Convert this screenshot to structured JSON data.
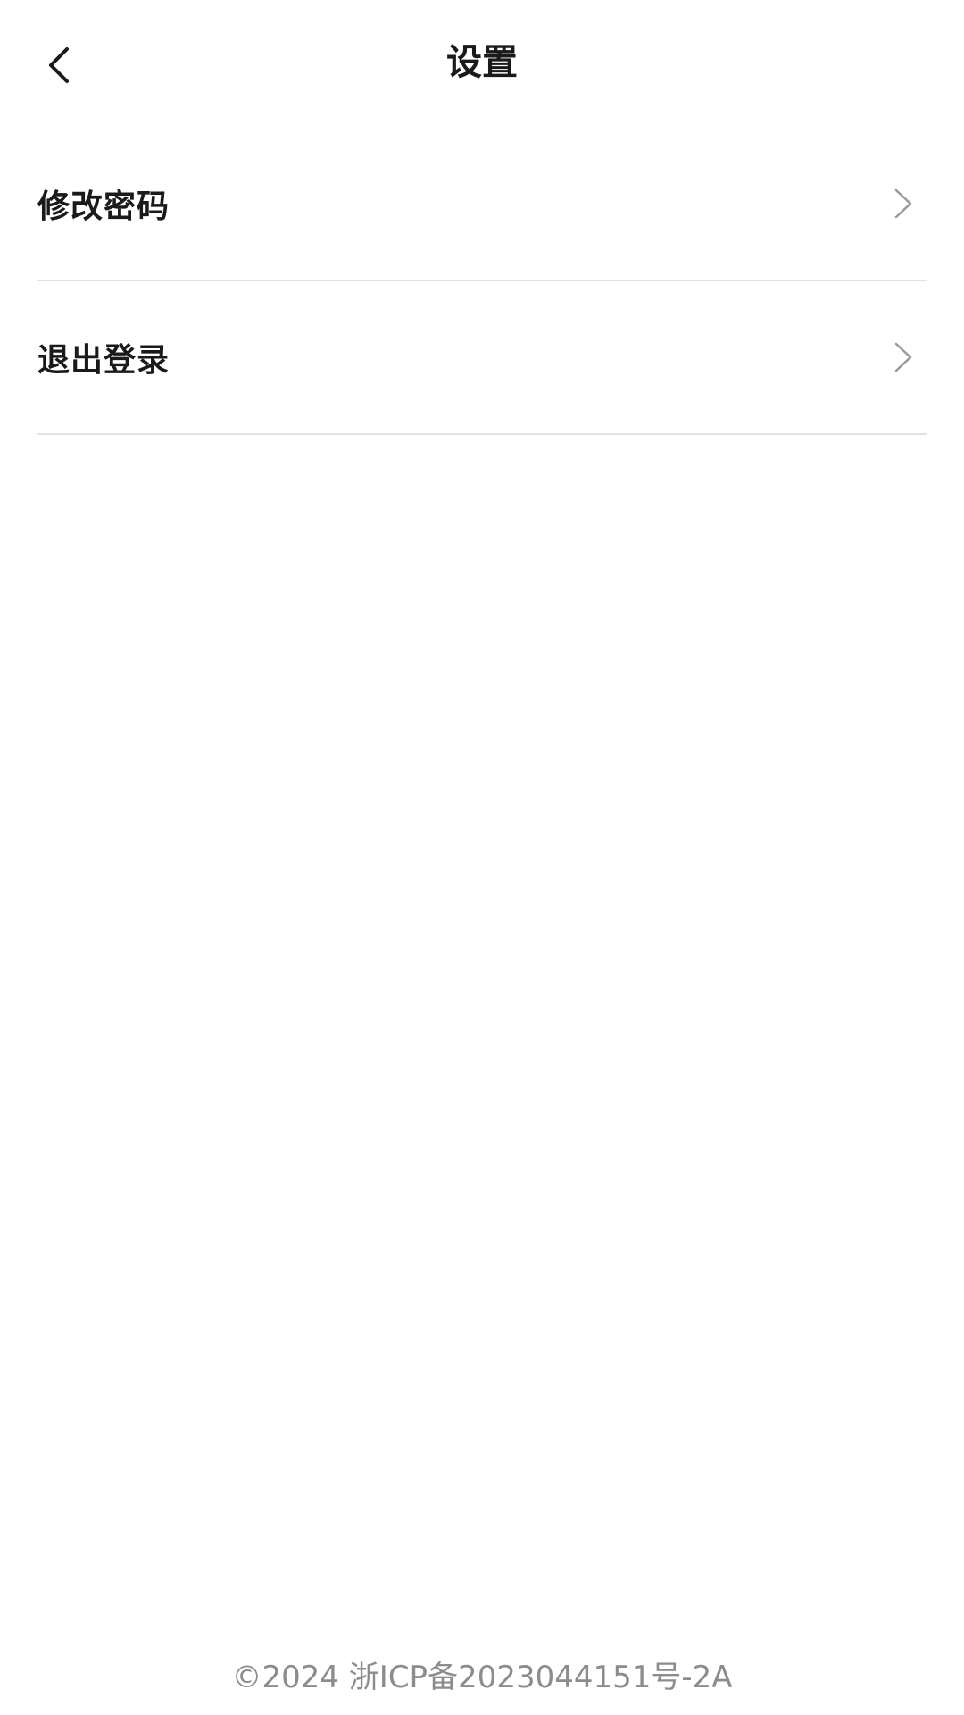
{
  "header": {
    "title": "设置",
    "back_icon": "chevron-left-icon"
  },
  "menu": {
    "items": [
      {
        "label": "修改密码",
        "icon": "chevron-right-icon"
      },
      {
        "label": "退出登录",
        "icon": "chevron-right-icon"
      }
    ]
  },
  "footer": {
    "text": "©2024 浙ICP备2023044151号-2A"
  },
  "colors": {
    "background": "#ffffff",
    "text": "#1a1a1a",
    "divider": "#e2e2e2",
    "chevron": "#9a9a9a",
    "footer_text": "#8c8c8c"
  }
}
